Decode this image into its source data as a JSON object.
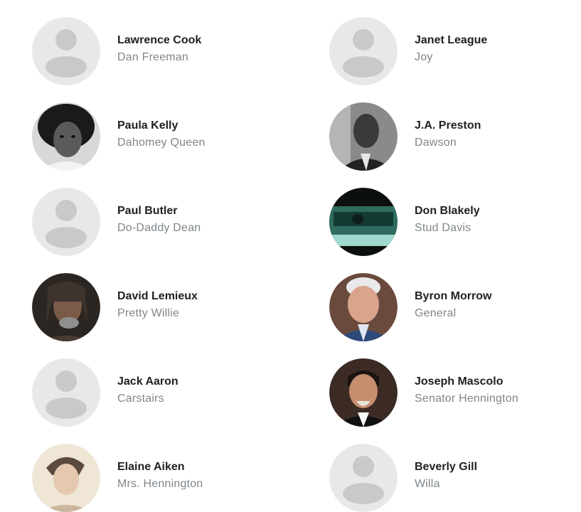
{
  "cast": [
    {
      "actor": "Lawrence Cook",
      "character": "Dan Freeman",
      "photo": "placeholder-person-icon"
    },
    {
      "actor": "Janet League",
      "character": "Joy",
      "photo": "placeholder-person-icon"
    },
    {
      "actor": "Paula Kelly",
      "character": "Dahomey Queen",
      "photo": "actor-photo"
    },
    {
      "actor": "J.A. Preston",
      "character": "Dawson",
      "photo": "actor-photo"
    },
    {
      "actor": "Paul Butler",
      "character": "Do-Daddy Dean",
      "photo": "placeholder-person-icon"
    },
    {
      "actor": "Don Blakely",
      "character": "Stud Davis",
      "photo": "actor-photo"
    },
    {
      "actor": "David Lemieux",
      "character": "Pretty Willie",
      "photo": "actor-photo"
    },
    {
      "actor": "Byron Morrow",
      "character": "General",
      "photo": "actor-photo"
    },
    {
      "actor": "Jack Aaron",
      "character": "Carstairs",
      "photo": "placeholder-person-icon"
    },
    {
      "actor": "Joseph Mascolo",
      "character": "Senator Hennington",
      "photo": "actor-photo"
    },
    {
      "actor": "Elaine Aiken",
      "character": "Mrs. Hennington",
      "photo": "actor-photo"
    },
    {
      "actor": "Beverly Gill",
      "character": "Willa",
      "photo": "placeholder-person-icon"
    }
  ],
  "colors": {
    "actor_text": "#202124",
    "character_text": "#80868b",
    "placeholder_bg": "#e8e8e8",
    "placeholder_fg": "#c9c9c9"
  }
}
